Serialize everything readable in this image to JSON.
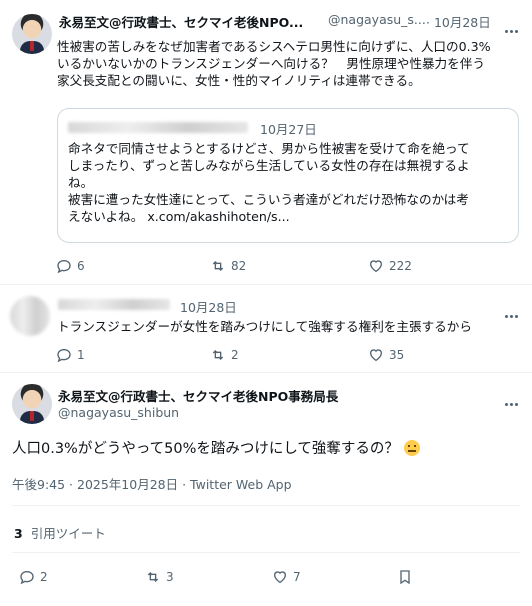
{
  "tweet1": {
    "name": "永易至文@行政書士、セクマイ老後NPO...",
    "handle": "@nagayasu_s...",
    "date": "· 10月28日",
    "text_lines": [
      "性被害の苦しみをなぜ加害者であるシスヘテロ男性に向けずに、人口の0.3%",
      "いるかいないかのトランスジェンダーへ向ける？　男性原理や性暴力を伴う",
      "家父長支配との闘いに、女性・性的マイノリティは連帯できる。"
    ],
    "quote": {
      "date": "10月27日",
      "text_lines": [
        "命ネタで同情させようとするけどさ、男から性被害を受けて命を絶って",
        "しまったり、ずっと苦しみながら生活している女性の存在は無視するよ",
        "ね。",
        "被害に遭った女性達にとって、こういう者達がどれだけ恐怖なのかは考",
        "えないよね。 x.com/akashihoten/s..."
      ]
    },
    "replies": "6",
    "retweets": "82",
    "likes": "222"
  },
  "tweet2": {
    "date": "10月28日",
    "text": "トランスジェンダーが女性を踏みつけにして強奪する権利を主張するから",
    "replies": "1",
    "retweets": "2",
    "likes": "35"
  },
  "main": {
    "name": "永易至文@行政書士、セクマイ老後NPO事務局長",
    "handle": "@nagayasu_shibun",
    "text": "人口0.3%がどうやって50%を踏みつけにして強奪するの？",
    "timestamp": "午後9:45 · 2025年10月28日 · Twitter Web App",
    "quote_count": "3",
    "quote_label": "引用ツイート",
    "replies": "2",
    "retweets": "3",
    "likes": "7"
  },
  "icons": {
    "reply": "reply-icon",
    "retweet": "retweet-icon",
    "like": "heart-icon",
    "bookmark": "bookmark-icon",
    "more": "more-icon"
  },
  "colors": {
    "text": "#0f1419",
    "secondary": "#536471",
    "border": "#cfd9de"
  }
}
